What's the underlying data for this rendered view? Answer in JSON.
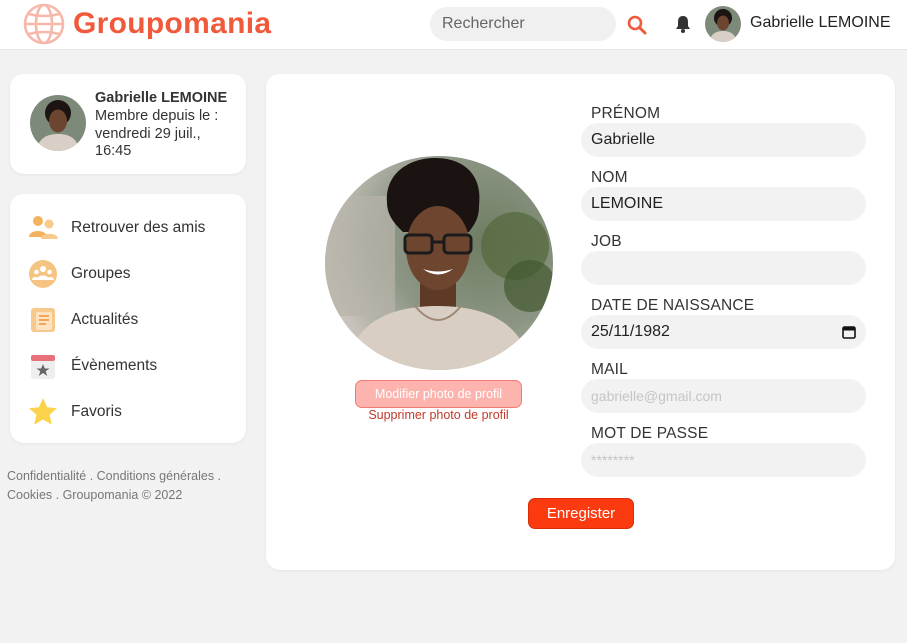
{
  "header": {
    "brand": "Groupomania",
    "search_placeholder": "Rechercher",
    "user_name": "Gabrielle LEMOINE"
  },
  "profile_card": {
    "name": "Gabrielle LEMOINE",
    "member_since": "Membre depuis le : vendredi 29 juil., 16:45"
  },
  "menu": {
    "items": [
      {
        "label": "Retrouver des amis",
        "icon": "friends-icon"
      },
      {
        "label": "Groupes",
        "icon": "groups-icon"
      },
      {
        "label": "Actualités",
        "icon": "news-icon"
      },
      {
        "label": "Évènements",
        "icon": "calendar-icon"
      },
      {
        "label": "Favoris",
        "icon": "star-icon"
      }
    ]
  },
  "footer": {
    "text": "Confidentialité . Conditions générales . Cookies . Groupomania © 2022"
  },
  "form": {
    "modify_photo": "Modifier photo de profil",
    "delete_photo": "Supprimer photo de profil",
    "fields": {
      "prenom": {
        "label": "PRÉNOM",
        "value": "Gabrielle"
      },
      "nom": {
        "label": "NOM",
        "value": "LEMOINE"
      },
      "job": {
        "label": "JOB",
        "value": ""
      },
      "naissance": {
        "label": "DATE DE NAISSANCE",
        "value": "25/11/1982"
      },
      "mail": {
        "label": "MAIL",
        "placeholder": "gabrielle@gmail.com"
      },
      "password": {
        "label": "MOT DE PASSE",
        "placeholder": "********"
      }
    },
    "save": "Enregister"
  },
  "colors": {
    "brand": "#f0593a",
    "save_button": "#fb3a0f",
    "modify_button": "#fdb3ae"
  }
}
